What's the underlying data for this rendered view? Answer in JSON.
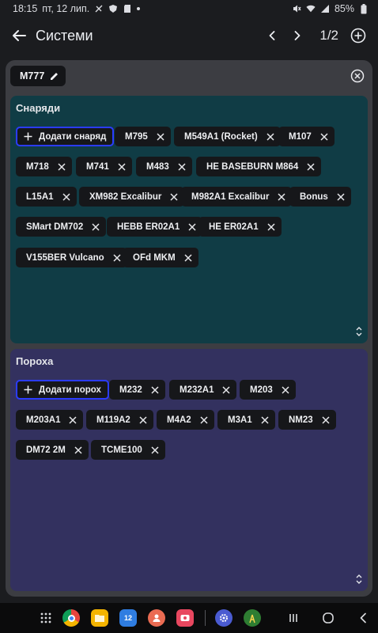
{
  "status": {
    "time": "18:15",
    "date": "пт, 12 лип.",
    "battery": "85%"
  },
  "appbar": {
    "title": "Системи",
    "page": "1/2"
  },
  "system": {
    "name": "M777"
  },
  "shells": {
    "title": "Снаряди",
    "add_label": "Додати снаряд",
    "items": [
      "M795",
      "M549A1 (Rocket)",
      "M107",
      "M718",
      "M741",
      "M483",
      "HE BASEBURN M864",
      "L15A1",
      "XM982 Excalibur",
      "M982A1 Excalibur",
      "Bonus",
      "SMart DM702",
      "HEBB ER02A1",
      "HE ER02A1",
      "V155BER Vulcano",
      "OFd MKM"
    ]
  },
  "powders": {
    "title": "Пороха",
    "add_label": "Додати порох",
    "items": [
      "M232",
      "M232A1",
      "M203",
      "M203A1",
      "M119A2",
      "M4A2",
      "M3A1",
      "NM23",
      "DM72 2M",
      "TCME100"
    ]
  },
  "navbar": {
    "apps": [
      {
        "name": "apps-grid-icon"
      },
      {
        "name": "chrome-icon",
        "color": "#e8453c"
      },
      {
        "name": "files-icon",
        "color": "#f4b400"
      },
      {
        "name": "calendar-icon",
        "color": "#2f7de1",
        "label": "12"
      },
      {
        "name": "contacts-icon",
        "color": "#ea6b52"
      },
      {
        "name": "screen-recorder-icon",
        "color": "#e8475f"
      },
      {
        "name": "settings-icon",
        "color": "#4a5bd1"
      },
      {
        "name": "signal-app-icon",
        "color": "#2e7d32"
      }
    ]
  }
}
